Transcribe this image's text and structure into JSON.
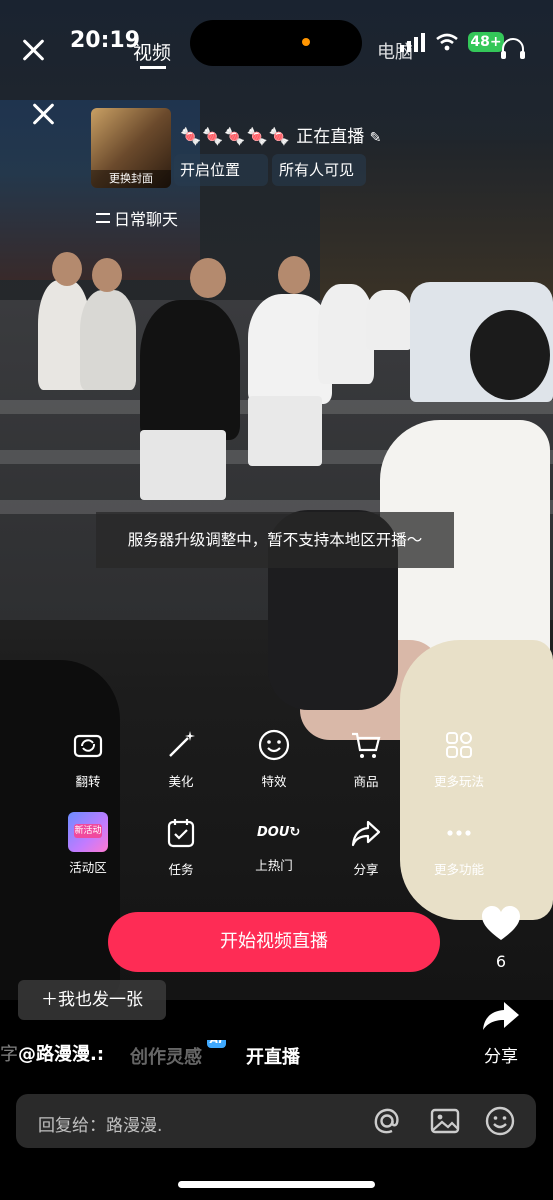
{
  "status_bar": {
    "time": "20:19",
    "tab_left": "视频",
    "tab_right": "电脑",
    "battery": "48+"
  },
  "live_setup": {
    "cover_label": "更换封面",
    "name_decor": "🍬🍬🍬🍬🍬",
    "live_status": "正在直播",
    "location_toggle": "开启位置",
    "visibility": "所有人可见",
    "category": "日常聊天"
  },
  "toast": "服务器升级调整中，暂不支持本地区开播～",
  "tools_row1": [
    {
      "label": "翻转",
      "icon": "flip-camera-icon"
    },
    {
      "label": "美化",
      "icon": "magic-wand-icon"
    },
    {
      "label": "特效",
      "icon": "smiley-icon"
    },
    {
      "label": "商品",
      "icon": "cart-icon"
    },
    {
      "label": "更多玩法",
      "icon": "grid-icon"
    }
  ],
  "tools_row2": [
    {
      "label": "活动区",
      "icon": "activity-thumb-icon",
      "thumb_text": "新活动"
    },
    {
      "label": "任务",
      "icon": "task-icon"
    },
    {
      "label": "上热门",
      "icon": "dou-plus-icon",
      "icon_text": "DOU"
    },
    {
      "label": "分享",
      "icon": "share-icon"
    },
    {
      "label": "更多功能",
      "icon": "more-icon"
    }
  ],
  "start_button": "开始视频直播",
  "like_count": "6",
  "share_label": "分享",
  "post_button": "＋我也发一张",
  "bottom_bar": {
    "author_prefix": "字",
    "author": "@路漫漫.:",
    "inspire": "创作灵感",
    "ai_badge": "AI",
    "start_live": "开直播"
  },
  "reply_placeholder": "回复给：路漫漫.",
  "colors": {
    "accent": "#fe2c55",
    "battery": "#34c759",
    "ai_badge": "#3fa9ff"
  }
}
